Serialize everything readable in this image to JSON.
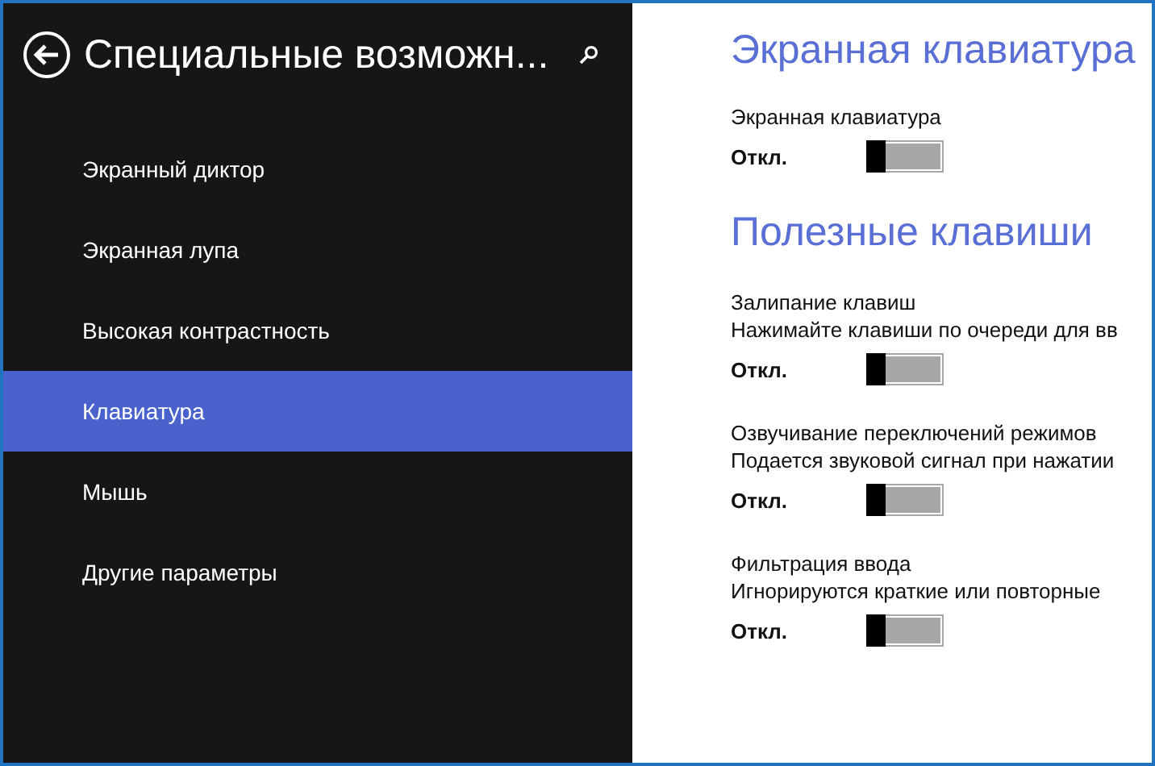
{
  "sidebar": {
    "title": "Специальные возможн...",
    "items": [
      {
        "label": "Экранный диктор",
        "selected": false
      },
      {
        "label": "Экранная лупа",
        "selected": false
      },
      {
        "label": "Высокая контрастность",
        "selected": false
      },
      {
        "label": "Клавиатура",
        "selected": true
      },
      {
        "label": "Мышь",
        "selected": false
      },
      {
        "label": "Другие параметры",
        "selected": false
      }
    ]
  },
  "sections": [
    {
      "heading": "Экранная клавиатура",
      "settings": [
        {
          "label": "Экранная клавиатура",
          "state_text": "Откл.",
          "on": false
        }
      ]
    },
    {
      "heading": "Полезные клавиши",
      "settings": [
        {
          "label": "Залипание клавиш",
          "description": "Нажимайте клавиши по очереди для вв",
          "state_text": "Откл.",
          "on": false
        },
        {
          "label": "Озвучивание переключений режимов",
          "description": "Подается звуковой сигнал при нажатии",
          "state_text": "Откл.",
          "on": false
        },
        {
          "label": "Фильтрация ввода",
          "description": "Игнорируются краткие или повторные",
          "state_text": "Откл.",
          "on": false
        }
      ]
    }
  ]
}
